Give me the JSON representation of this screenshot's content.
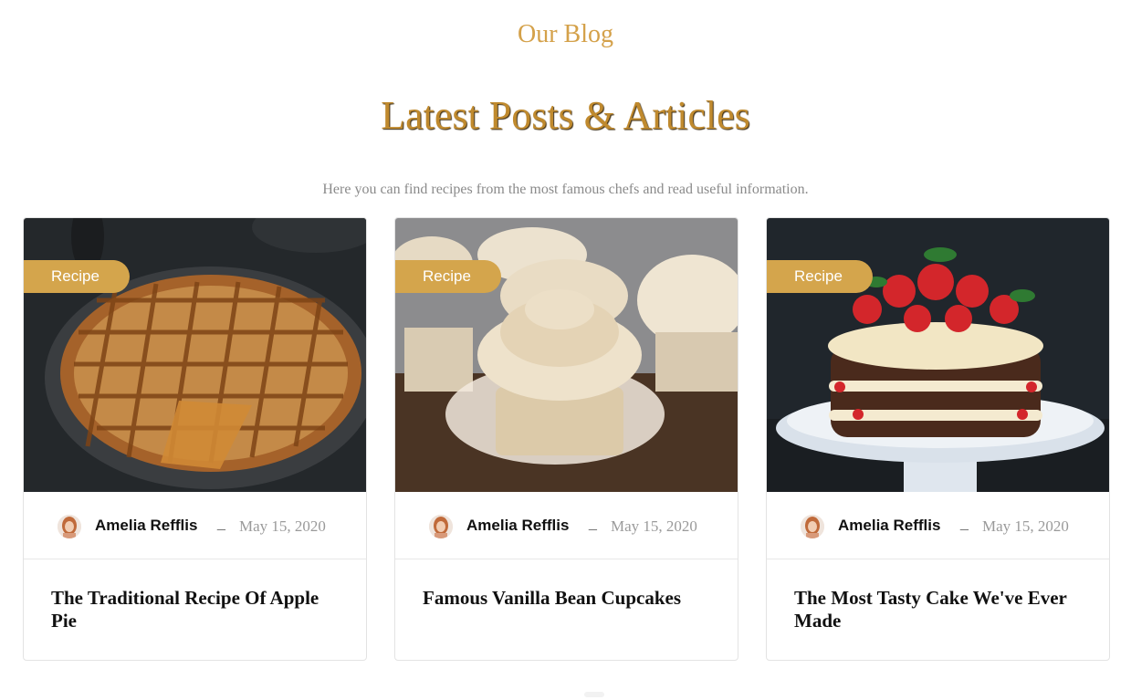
{
  "section": {
    "eyebrow": "Our Blog",
    "headline": "Latest Posts & Articles",
    "intro": "Here you can find recipes from the most famous chefs and read useful information."
  },
  "colors": {
    "accent": "#d4a54c",
    "heading": "#c08a2e"
  },
  "posts": [
    {
      "tag": "Recipe",
      "image": "apple-pie-photo",
      "author": "Amelia Refflis",
      "separator": "_",
      "date": "May 15, 2020",
      "title": "The Traditional Recipe Of Apple Pie"
    },
    {
      "tag": "Recipe",
      "image": "vanilla-cupcakes-photo",
      "author": "Amelia Refflis",
      "separator": "_",
      "date": "May 15, 2020",
      "title": "Famous Vanilla Bean Cupcakes"
    },
    {
      "tag": "Recipe",
      "image": "strawberry-layer-cake-photo",
      "author": "Amelia Refflis",
      "separator": "_",
      "date": "May 15, 2020",
      "title": "The Most Tasty Cake We've Ever Made"
    }
  ]
}
